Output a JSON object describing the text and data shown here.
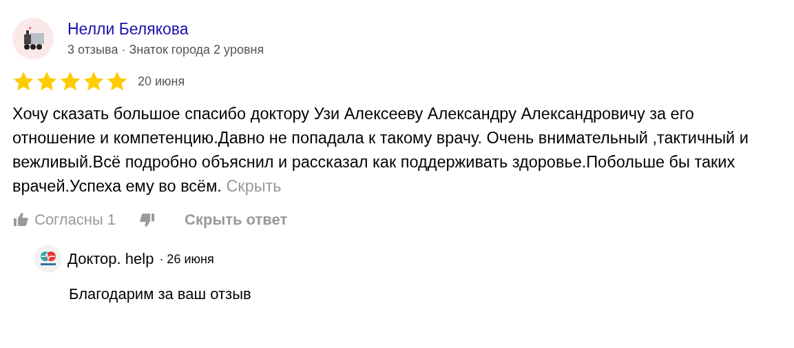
{
  "review": {
    "author": "Нелли Белякова",
    "meta": "3 отзыва · Знаток города 2 уровня",
    "stars": 5,
    "date": "20 июня",
    "text": "Хочу сказать большое спасибо доктору Узи Алексееву Александру Александровичу за его отношение и компетенцию.Давно не попадала к такому врачу. Очень внимательный ,тактичный и вежливый.Всё подробно объяснил и рассказал как поддерживать здоровье.Побольше бы таких врачей.Успеха ему во всём.",
    "collapse_link": "Скрыть"
  },
  "actions": {
    "like_label": "Согласны 1",
    "hide_reply": "Скрыть ответ"
  },
  "reply": {
    "author": "Доктор. help",
    "date": "· 26 июня",
    "text": "Благодарим за ваш отзыв"
  }
}
